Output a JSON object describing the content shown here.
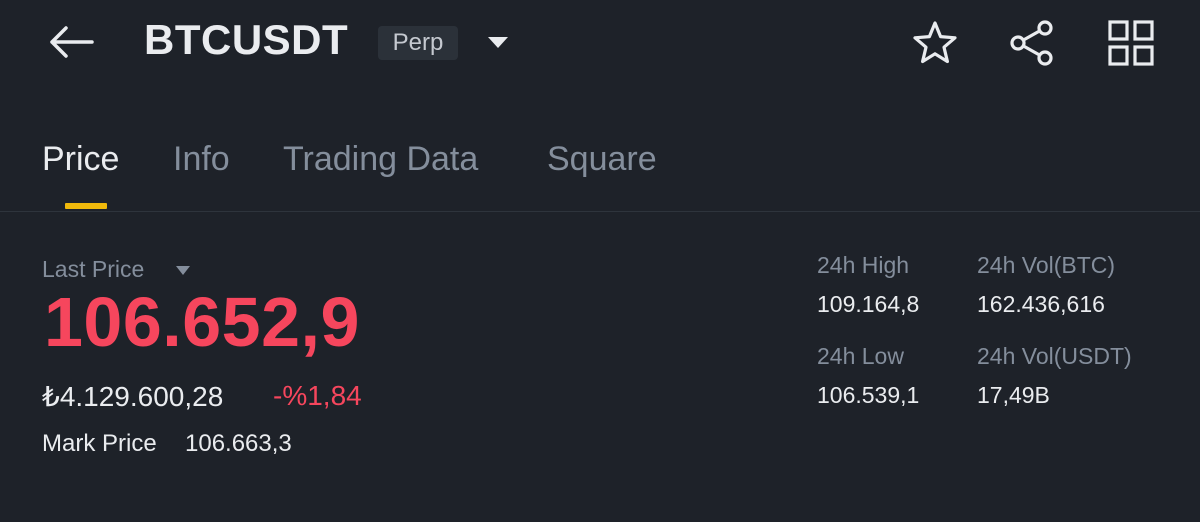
{
  "header": {
    "symbol": "BTCUSDT",
    "contract_type": "Perp",
    "icons": [
      "back-arrow-icon",
      "caret-down-icon",
      "star-icon",
      "share-icon",
      "grid-icon"
    ]
  },
  "tabs": [
    {
      "label": "Price",
      "active": true
    },
    {
      "label": "Info",
      "active": false
    },
    {
      "label": "Trading Data",
      "active": false
    },
    {
      "label": "Square",
      "active": false
    }
  ],
  "price": {
    "last_price_label": "Last Price",
    "last_price": "106.652,9",
    "fiat_price": "₺4.129.600,28",
    "change_percent": "-%1,84",
    "mark_price_label": "Mark Price",
    "mark_price": "106.663,3"
  },
  "stats": {
    "high_label": "24h High",
    "high_value": "109.164,8",
    "vol_btc_label": "24h Vol(BTC)",
    "vol_btc_value": "162.436,616",
    "low_label": "24h Low",
    "low_value": "106.539,1",
    "vol_usdt_label": "24h Vol(USDT)",
    "vol_usdt_value": "17,49B"
  },
  "colors": {
    "background": "#1e2229",
    "down": "#f6465d",
    "accent": "#f0b90b",
    "muted": "#848e9c"
  }
}
